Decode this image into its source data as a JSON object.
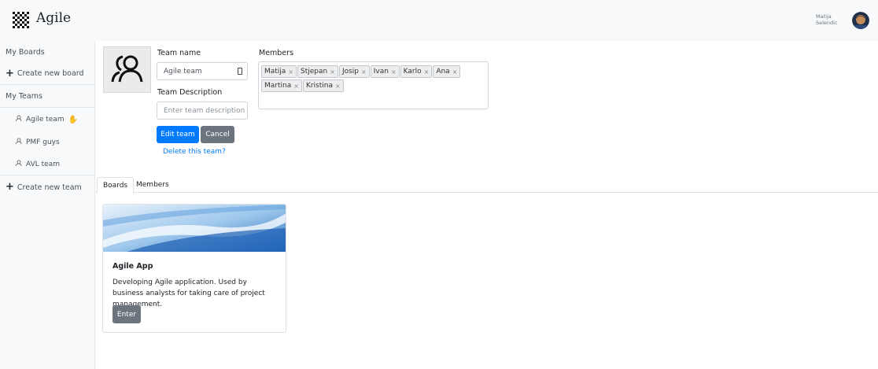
{
  "app": {
    "brand": "Agile"
  },
  "user": {
    "first_name": "Matija",
    "last_name": "Selendic"
  },
  "sidebar": {
    "my_boards": "My Boards",
    "create_board": "Create new board",
    "my_teams": "My Teams",
    "teams": [
      "Agile team",
      "PMF guys",
      "AVL team"
    ],
    "create_team": "Create new team"
  },
  "form": {
    "team_name_label": "Team name",
    "team_name_value": "Agile team",
    "team_desc_label": "Team Description",
    "team_desc_placeholder": "Enter team description",
    "edit_label": "Edit team",
    "cancel_label": "Cancel",
    "delete_link": "Delete this team?",
    "members_label": "Members",
    "members": [
      "Matija",
      "Stjepan",
      "Josip",
      "Ivan",
      "Karlo",
      "Ana",
      "Martina",
      "Kristina"
    ]
  },
  "tabs": [
    "Boards",
    "Members"
  ],
  "board_card": {
    "title": "Agile App",
    "description": "Developing Agile application. Used by business analysts for taking care of project management.",
    "button": "Enter"
  },
  "colors": {
    "primary": "#007bff",
    "secondary": "#6c757d",
    "hand_icon": "#1a3de8"
  }
}
